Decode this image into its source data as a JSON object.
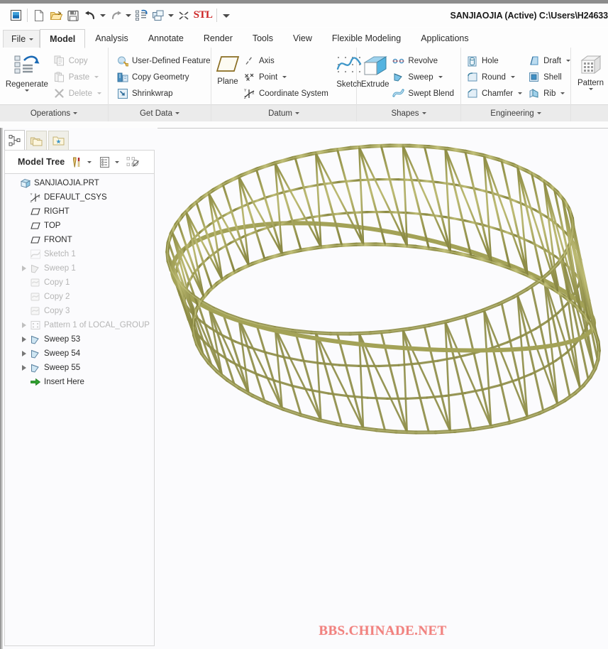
{
  "window": {
    "title": "SANJIAOJIA (Active) C:\\Users\\H24633"
  },
  "quick_access": {
    "items": [
      {
        "name": "window-restore-icon",
        "label": "Window"
      },
      {
        "name": "new-file-icon",
        "label": "New"
      },
      {
        "name": "open-folder-icon",
        "label": "Open"
      },
      {
        "name": "save-icon",
        "label": "Save"
      },
      {
        "name": "undo-icon",
        "label": "Undo"
      },
      {
        "name": "redo-icon",
        "label": "Redo"
      },
      {
        "name": "regenerate-icon",
        "label": "Regenerate"
      },
      {
        "name": "window-switch-icon",
        "label": "Switch Window"
      },
      {
        "name": "close-window-icon",
        "label": "Close"
      },
      {
        "name": "stl-icon",
        "label": "STL"
      },
      {
        "name": "customize-qat-icon",
        "label": "Customize"
      }
    ]
  },
  "menu": {
    "file_label": "File",
    "tabs": [
      {
        "label": "Model",
        "active": true
      },
      {
        "label": "Analysis",
        "active": false
      },
      {
        "label": "Annotate",
        "active": false
      },
      {
        "label": "Render",
        "active": false
      },
      {
        "label": "Tools",
        "active": false
      },
      {
        "label": "View",
        "active": false
      },
      {
        "label": "Flexible Modeling",
        "active": false
      },
      {
        "label": "Applications",
        "active": false
      }
    ]
  },
  "ribbon": {
    "groups": [
      {
        "label": "Operations",
        "big": {
          "label": "Regenerate",
          "icon": "regenerate-icon",
          "has_menu": true
        },
        "small": [
          {
            "label": "Copy",
            "icon": "copy-icon",
            "disabled": true,
            "dropdown": false
          },
          {
            "label": "Paste",
            "icon": "paste-icon",
            "disabled": true,
            "dropdown": true
          },
          {
            "label": "Delete",
            "icon": "delete-icon",
            "disabled": true,
            "dropdown": true
          }
        ]
      },
      {
        "label": "Get Data",
        "small": [
          {
            "label": "User-Defined Feature",
            "icon": "udf-icon",
            "disabled": false,
            "dropdown": false
          },
          {
            "label": "Copy Geometry",
            "icon": "copy-geometry-icon",
            "disabled": false,
            "dropdown": false
          },
          {
            "label": "Shrinkwrap",
            "icon": "shrinkwrap-icon",
            "disabled": false,
            "dropdown": false
          }
        ]
      },
      {
        "label": "Datum",
        "big": {
          "label": "Plane",
          "icon": "datum-plane-icon",
          "has_menu": false
        },
        "small": [
          {
            "label": "Axis",
            "icon": "datum-axis-icon",
            "disabled": false,
            "dropdown": false
          },
          {
            "label": "Point",
            "icon": "datum-point-icon",
            "disabled": false,
            "dropdown": true
          },
          {
            "label": "Coordinate System",
            "icon": "coordinate-system-icon",
            "disabled": false,
            "dropdown": false
          }
        ],
        "big_right": {
          "label": "Sketch",
          "icon": "sketch-icon",
          "has_menu": false
        }
      },
      {
        "label": "Shapes",
        "big": {
          "label": "Extrude",
          "icon": "extrude-icon",
          "has_menu": false
        },
        "small": [
          {
            "label": "Revolve",
            "icon": "revolve-icon",
            "disabled": false,
            "dropdown": false
          },
          {
            "label": "Sweep",
            "icon": "sweep-icon",
            "disabled": false,
            "dropdown": true
          },
          {
            "label": "Swept Blend",
            "icon": "swept-blend-icon",
            "disabled": false,
            "dropdown": false
          }
        ]
      },
      {
        "label": "Engineering",
        "small": [
          {
            "label": "Hole",
            "icon": "hole-icon",
            "disabled": false,
            "dropdown": false
          },
          {
            "label": "Round",
            "icon": "round-icon",
            "disabled": false,
            "dropdown": true
          },
          {
            "label": "Chamfer",
            "icon": "chamfer-icon",
            "disabled": false,
            "dropdown": true
          }
        ],
        "small2": [
          {
            "label": "Draft",
            "icon": "draft-icon",
            "disabled": false,
            "dropdown": true
          },
          {
            "label": "Shell",
            "icon": "shell-icon",
            "disabled": false,
            "dropdown": false
          },
          {
            "label": "Rib",
            "icon": "rib-icon",
            "disabled": false,
            "dropdown": true
          }
        ]
      },
      {
        "label": "",
        "big": {
          "label": "Pattern",
          "icon": "pattern-icon",
          "has_menu": true
        }
      }
    ]
  },
  "left_panel": {
    "nav_tabs": [
      {
        "name": "model-tree-tab",
        "icon": "tree-nodes-icon",
        "selected": true
      },
      {
        "name": "folder-browser-tab",
        "icon": "folders-icon",
        "selected": false
      },
      {
        "name": "favorites-tab",
        "icon": "favorites-folder-icon",
        "selected": false
      }
    ],
    "tree_title": "Model Tree",
    "header_buttons": [
      {
        "name": "tree-settings-icon",
        "label": "Settings",
        "dropdown": true
      },
      {
        "name": "tree-display-icon",
        "label": "Display",
        "dropdown": true
      },
      {
        "name": "tree-filter-icon",
        "label": "Filter",
        "dropdown": false
      }
    ],
    "tree_items": [
      {
        "label": "SANJIAOJIA.PRT",
        "icon": "part-icon",
        "indent": 0,
        "expandable": false,
        "dim": false
      },
      {
        "label": "DEFAULT_CSYS",
        "icon": "csys-icon",
        "indent": 1,
        "expandable": false,
        "dim": false
      },
      {
        "label": "RIGHT",
        "icon": "datum-plane-icon",
        "indent": 1,
        "expandable": false,
        "dim": false
      },
      {
        "label": "TOP",
        "icon": "datum-plane-icon",
        "indent": 1,
        "expandable": false,
        "dim": false
      },
      {
        "label": "FRONT",
        "icon": "datum-plane-icon",
        "indent": 1,
        "expandable": false,
        "dim": false
      },
      {
        "label": "Sketch 1",
        "icon": "sketch-feat-icon",
        "indent": 1,
        "expandable": false,
        "dim": true
      },
      {
        "label": "Sweep 1",
        "icon": "sweep-feat-icon",
        "indent": 1,
        "expandable": true,
        "dim": true
      },
      {
        "label": "Copy 1",
        "icon": "copy-feat-icon",
        "indent": 1,
        "expandable": false,
        "dim": true
      },
      {
        "label": "Copy 2",
        "icon": "copy-feat-icon",
        "indent": 1,
        "expandable": false,
        "dim": true
      },
      {
        "label": "Copy 3",
        "icon": "copy-feat-icon",
        "indent": 1,
        "expandable": false,
        "dim": true
      },
      {
        "label": "Pattern 1 of LOCAL_GROUP",
        "icon": "pattern-feat-icon",
        "indent": 1,
        "expandable": true,
        "dim": true
      },
      {
        "label": "Sweep 53",
        "icon": "sweep-feat-icon",
        "indent": 1,
        "expandable": true,
        "dim": false
      },
      {
        "label": "Sweep 54",
        "icon": "sweep-feat-icon",
        "indent": 1,
        "expandable": true,
        "dim": false
      },
      {
        "label": "Sweep 55",
        "icon": "sweep-feat-icon",
        "indent": 1,
        "expandable": true,
        "dim": false
      },
      {
        "label": "Insert Here",
        "icon": "insert-here-icon",
        "indent": 1,
        "expandable": false,
        "dim": false
      }
    ]
  },
  "viewport": {
    "watermark": "BBS.CHINADE.NET",
    "model_name": "toroidal-lattice-truss",
    "background": "#fbfbfd"
  },
  "colors": {
    "model_olive_light": "#b9b86a",
    "model_olive": "#9a9a4e",
    "model_olive_dark": "#7d7d3a",
    "watermark": "#f1827f",
    "ribbon_group_bar": "#ebebeb",
    "accent_blue": "#4a9fd4",
    "stl_red": "#cc2222"
  }
}
